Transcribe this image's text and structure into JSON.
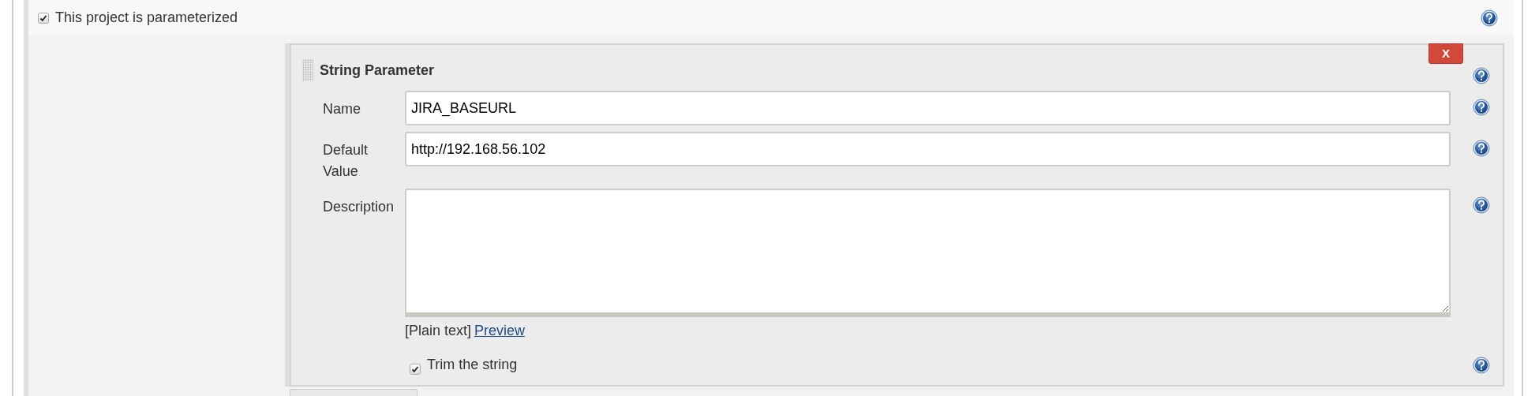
{
  "parameterized": {
    "label": "This project is parameterized",
    "checked": true
  },
  "parameter": {
    "title": "String Parameter",
    "delete_button": "X",
    "fields": [
      {
        "kind": "input",
        "label": "Name",
        "value": "JIRA_BASEURL"
      },
      {
        "kind": "input",
        "label": "Default Value",
        "value": "http://192.168.56.102"
      },
      {
        "kind": "textarea",
        "label": "Description"
      }
    ],
    "format_note": "[Plain text]",
    "preview_link": "Preview",
    "trim": {
      "label": "Trim the string",
      "checked": true
    }
  }
}
